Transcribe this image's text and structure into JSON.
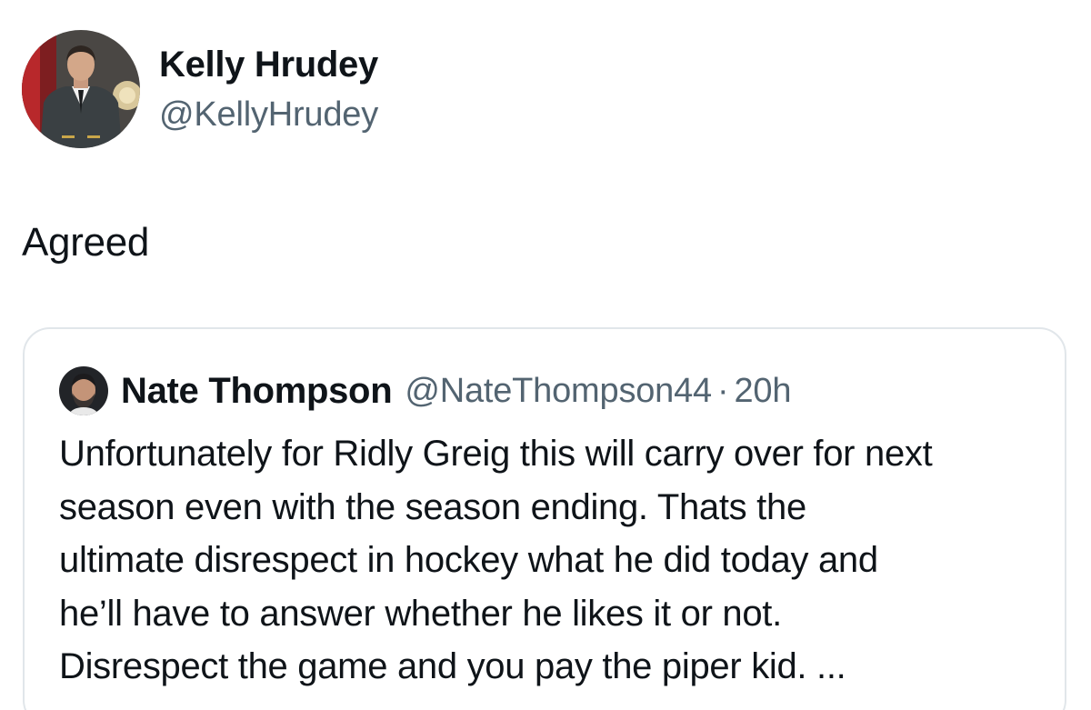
{
  "author": {
    "name": "Kelly Hrudey",
    "handle": "@KellyHrudey",
    "avatar_icon": "profile-photo"
  },
  "tweet": {
    "text": "Agreed"
  },
  "quoted_tweet": {
    "name": "Nate Thompson",
    "handle": "@NateThompson44",
    "separator": "·",
    "time": "20h",
    "avatar_icon": "profile-photo",
    "lines": [
      "Unfortunately for Ridly Greig this will carry over for next",
      "season even with the season ending. Thats the",
      "ultimate disrespect in hockey what he did today and",
      "he’ll have to answer whether he likes it or not.",
      "Disrespect the game and you pay the piper kid. ..."
    ]
  },
  "colors": {
    "text_primary": "#0f1419",
    "text_secondary": "#536471",
    "card_border": "#e1e6ea"
  }
}
